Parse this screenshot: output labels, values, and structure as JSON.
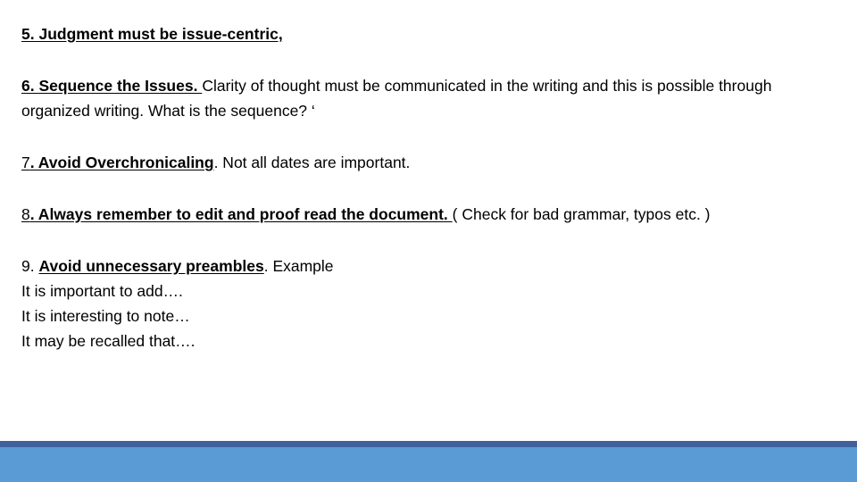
{
  "slide": {
    "background_color": "#FFFFFF",
    "text_color": "#000000",
    "paragraphs": [
      {
        "id": "item-5",
        "lines": [
          {
            "runs": [
              {
                "text": "5. Judgment must be issue-centric,",
                "style": "bold-underline"
              }
            ]
          }
        ]
      },
      {
        "id": "item-6",
        "lines": [
          {
            "runs": [
              {
                "text": "6. Sequence the Issues. ",
                "style": "bold-underline"
              },
              {
                "text": "Clarity of thought must be communicated in the writing and this is possible through organized writing. What is the sequence? ‘",
                "style": "regular"
              }
            ]
          }
        ]
      },
      {
        "id": "item-7",
        "lines": [
          {
            "runs": [
              {
                "text": "7",
                "style": "underline"
              },
              {
                "text": ". Avoid Overchronicaling",
                "style": "bold-underline"
              },
              {
                "text": ". Not all dates are important.",
                "style": "regular"
              }
            ]
          }
        ]
      },
      {
        "id": "item-8",
        "lines": [
          {
            "runs": [
              {
                "text": "8",
                "style": "underline"
              },
              {
                "text": ". Always remember to edit and proof read the document. ",
                "style": "bold-underline"
              },
              {
                "text": "( Check for bad grammar, typos etc. )",
                "style": "regular"
              }
            ]
          }
        ]
      },
      {
        "id": "item-9",
        "lines": [
          {
            "runs": [
              {
                "text": "9. ",
                "style": "regular"
              },
              {
                "text": "Avoid unnecessary preambles",
                "style": "bold-underline"
              },
              {
                "text": ". Example",
                "style": "regular"
              }
            ]
          }
        ]
      }
    ],
    "examples": [
      "It is important to add….",
      "It is interesting to note…",
      "It may be recalled that…."
    ],
    "footer": {
      "dark_bar_color": "#41619C",
      "light_bar_color": "#5B9BD5"
    }
  }
}
